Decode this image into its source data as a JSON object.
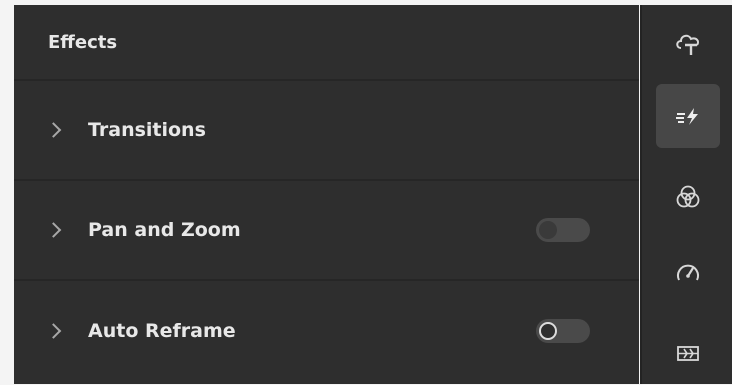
{
  "panel": {
    "title": "Effects",
    "rows": [
      {
        "label": "Transitions",
        "has_toggle": false
      },
      {
        "label": "Pan and Zoom",
        "has_toggle": true,
        "toggle_state": "disabled"
      },
      {
        "label": "Auto Reframe",
        "has_toggle": true,
        "toggle_state": "off"
      }
    ]
  },
  "rail": {
    "tools": [
      {
        "icon": "titles-icon",
        "active": false
      },
      {
        "icon": "effects-icon",
        "active": true
      },
      {
        "icon": "color-icon",
        "active": false
      },
      {
        "icon": "speed-icon",
        "active": false
      },
      {
        "icon": "audio-icon",
        "active": false
      }
    ]
  },
  "colors": {
    "panel_bg": "#2e2e2e",
    "text": "#e8e8e8",
    "active_tool_bg": "#474747"
  }
}
